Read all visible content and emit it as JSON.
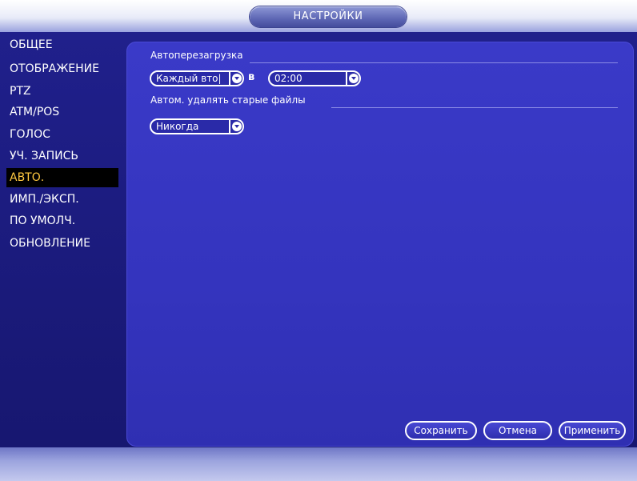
{
  "window": {
    "title": "НАСТРОЙКИ"
  },
  "nav": {
    "items": [
      {
        "label": "ОБЩЕЕ",
        "active": false
      },
      {
        "label": "ОТОБРАЖЕНИЕ",
        "active": false
      },
      {
        "label": "PTZ",
        "active": false
      },
      {
        "label": "ATM/POS",
        "active": false
      },
      {
        "label": "ГОЛОС",
        "active": false
      },
      {
        "label": "УЧ. ЗАПИСЬ",
        "active": false
      },
      {
        "label": "АВТО.",
        "active": true
      },
      {
        "label": "ИМП./ЭКСП.",
        "active": false
      },
      {
        "label": "ПО УМОЛЧ.",
        "active": false
      },
      {
        "label": "ОБНОВЛЕНИЕ",
        "active": false
      }
    ]
  },
  "auto_reboot": {
    "section_title": "Автоперезагрузка",
    "day_value": "Каждый вто|",
    "at_label": "в",
    "time_value": "02:00"
  },
  "auto_delete": {
    "section_title": "Автом. удалять старые файлы",
    "value": "Никогда"
  },
  "footer": {
    "save_label": "Сохранить",
    "cancel_label": "Отмена",
    "apply_label": "Применить"
  },
  "colors": {
    "accent_active_text": "#ffc940",
    "panel_blue": "#3434be",
    "window_blue": "#1c1c84"
  },
  "icons": {
    "dropdown": "chevron-down-icon"
  }
}
